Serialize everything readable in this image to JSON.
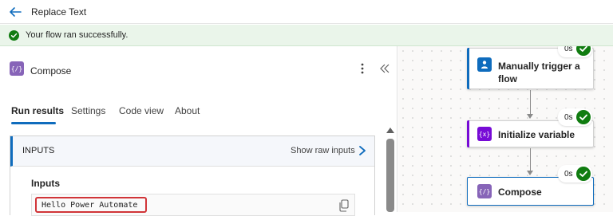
{
  "header": {
    "title": "Replace Text",
    "back_icon": "arrow-left-icon"
  },
  "banner": {
    "message": "Your flow ran successfully.",
    "icon": "check-circle-icon",
    "color": "#107c10"
  },
  "panel": {
    "title": "Compose",
    "icon_glyph": "{/}",
    "tabs": [
      {
        "label": "Run results",
        "active": true
      },
      {
        "label": "Settings",
        "active": false
      },
      {
        "label": "Code view",
        "active": false
      },
      {
        "label": "About",
        "active": false
      }
    ],
    "inputs_section": {
      "header": "INPUTS",
      "show_raw_label": "Show raw inputs",
      "field_label": "Inputs",
      "field_value": "Hello Power Automate"
    }
  },
  "flow": {
    "nodes": [
      {
        "label_line1": "Manually trigger a",
        "label_line2": "flow",
        "duration": "0s",
        "accent": "#0f6cbd"
      },
      {
        "label": "Initialize variable",
        "duration": "0s",
        "accent": "#770bd6",
        "icon_glyph": "{x}"
      },
      {
        "label": "Compose",
        "duration": "0s",
        "accent": "#8764b8",
        "icon_glyph": "{/}"
      }
    ]
  },
  "colors": {
    "brand_blue": "#0f6cbd",
    "success_green": "#107c10",
    "highlight_red": "#d13438"
  }
}
